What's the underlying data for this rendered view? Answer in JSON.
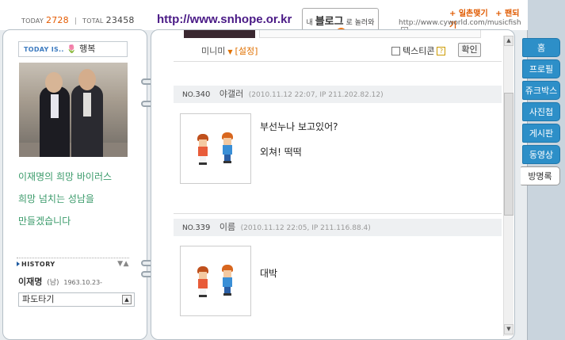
{
  "header": {
    "today_label": "TODAY",
    "today_count": "2728",
    "total_label": "TOTAL",
    "total_count": "23458",
    "site_url": "http://www.snhope.or.kr",
    "blog_tag_small": "내",
    "blog_tag_big": "블로그",
    "blog_tag_tail": "로 놀러와",
    "links": [
      "+ 일촌맺기",
      "+ 팬되기"
    ],
    "cy_url": "http://www.cyworld.com/musicfish"
  },
  "profile": {
    "today_is_label": "TODAY IS..",
    "mood_label": "행복",
    "intro_lines": [
      "이재명의 희망 바이러스",
      "희망 넘치는 성남을",
      "만들겠습니다"
    ],
    "history_label": "HISTORY",
    "name": "이재명",
    "sex": "(남)",
    "birthday": "1963.10.23-",
    "wave_select": "파도타기"
  },
  "guestbook": {
    "minimi_label": "미니미",
    "settings_label": "[설정]",
    "emoticon_label": "텍스티콘",
    "confirm_label": "확인",
    "entries": [
      {
        "no_label": "NO.",
        "number": "340",
        "author": "야갤러",
        "meta": "(2010.11.12 22:07, IP 211.202.82.12)",
        "lines": [
          "부선누나 보고있어?",
          "외쳐! 떡떡"
        ]
      },
      {
        "no_label": "NO.",
        "number": "339",
        "author": "이름",
        "meta": "(2010.11.12 22:05, IP 211.116.88.4)",
        "lines": [
          "대박"
        ]
      }
    ]
  },
  "tabs": [
    "홈",
    "프로필",
    "쥬크박스",
    "사진첩",
    "게시판",
    "동영상",
    "방명록"
  ],
  "active_tab": "방명록",
  "colors": {
    "tab_blue": "#2d8fc8",
    "accent_orange": "#e05a00",
    "intro_green": "#3a9a6a",
    "url_purple": "#4a1a86"
  }
}
